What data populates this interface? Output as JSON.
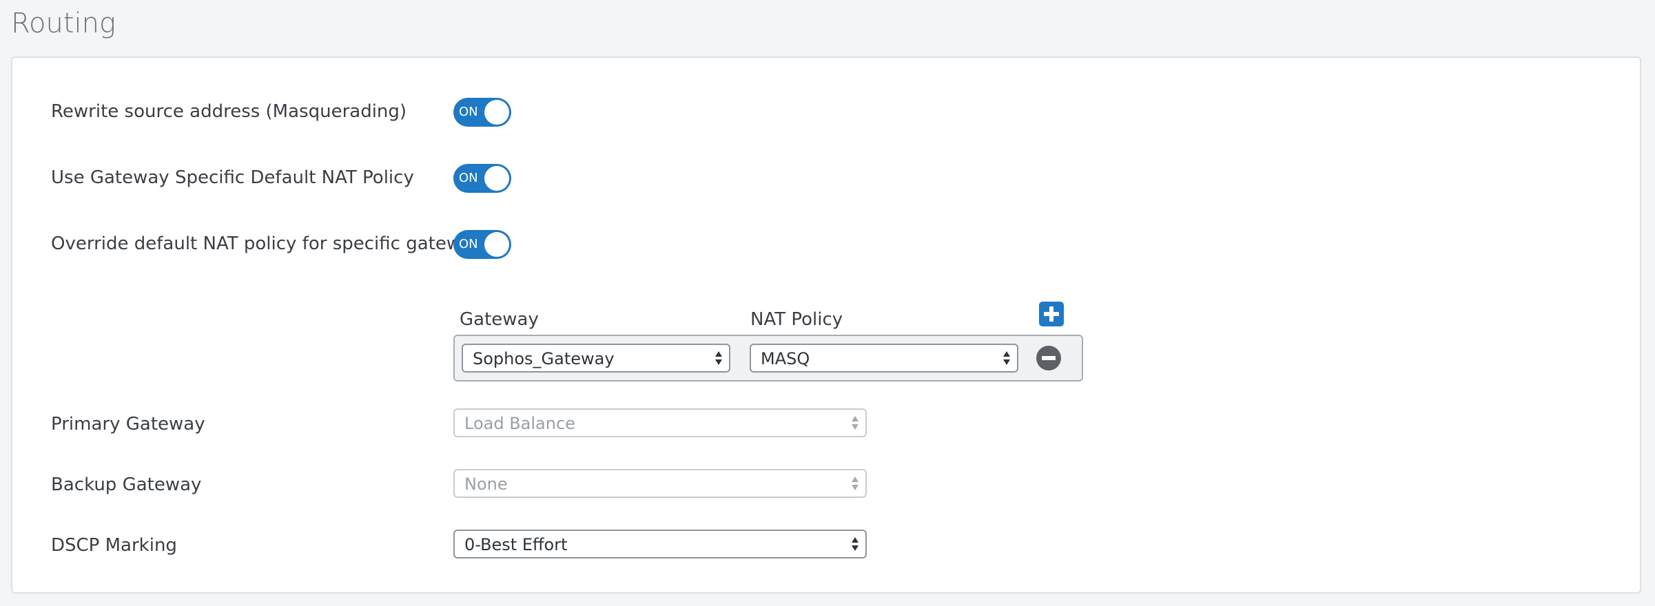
{
  "page": {
    "title": "Routing"
  },
  "toggles": [
    {
      "label": "Rewrite source address (Masquerading)",
      "state": "ON"
    },
    {
      "label": "Use Gateway Specific Default NAT Policy",
      "state": "ON"
    },
    {
      "label": "Override default NAT policy for specific gateway",
      "state": "ON"
    }
  ],
  "nat_table": {
    "gateway_header": "Gateway",
    "policy_header": "NAT Policy",
    "add_icon": "plus-icon",
    "remove_icon": "minus-circle-icon",
    "rows": [
      {
        "gateway": "Sophos_Gateway",
        "policy": "MASQ"
      }
    ]
  },
  "fields": {
    "primary_gateway": {
      "label": "Primary Gateway",
      "value": "Load Balance",
      "disabled": true
    },
    "backup_gateway": {
      "label": "Backup Gateway",
      "value": "None",
      "disabled": true
    },
    "dscp_marking": {
      "label": "DSCP Marking",
      "value": "0-Best Effort",
      "disabled": false
    }
  },
  "colors": {
    "accent": "#1f79c4",
    "remove_button": "#5d6166",
    "background": "#f4f5f7",
    "panel": "#ffffff"
  }
}
